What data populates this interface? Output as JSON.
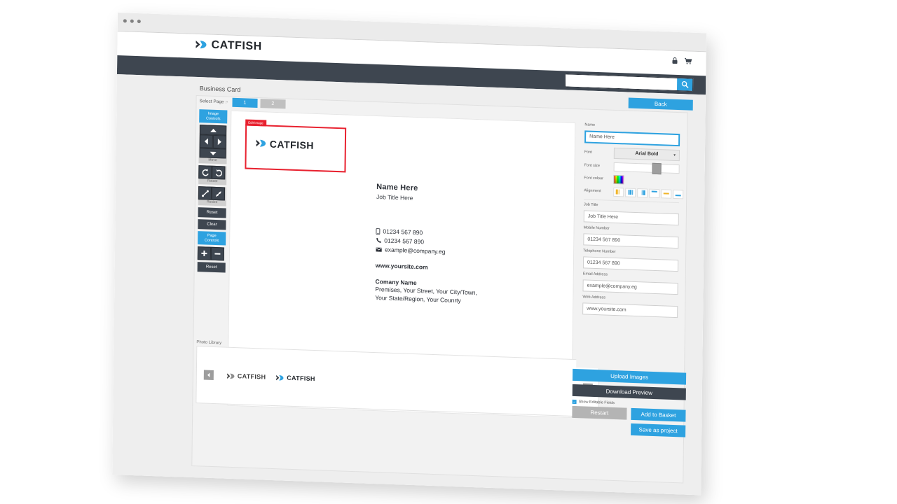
{
  "browser": {
    "dots": 3
  },
  "header": {
    "logo_word": "CATFISH",
    "lock_icon": "lock-icon",
    "cart_icon": "cart-icon"
  },
  "nav": {
    "search_value": "",
    "search_placeholder": "",
    "search_icon": "search-icon"
  },
  "toolbar_top": {
    "back_label": "Back"
  },
  "designer": {
    "title": "Business Card",
    "select_page_label": "Select Page :-",
    "pages": [
      {
        "label": "1",
        "active": true
      },
      {
        "label": "2",
        "active": false
      }
    ]
  },
  "tools": {
    "image_controls_label": "Image\nControls",
    "image_controls_line1": "Image",
    "image_controls_line2": "Controls",
    "move_label": "Move",
    "rotate_label": "Rotate",
    "resize_label": "Resize",
    "reset_label": "Reset",
    "clear_label": "Clear",
    "page_controls_line1": "Page",
    "page_controls_line2": "Controls",
    "page_reset_label": "Reset",
    "icons": {
      "up": "arrow-up-icon",
      "down": "arrow-down-icon",
      "left": "arrow-left-icon",
      "right": "arrow-right-icon",
      "rotate_ccw": "rotate-counterclockwise-icon",
      "rotate_cw": "rotate-clockwise-icon",
      "grow": "resize-grow-icon",
      "shrink": "resize-shrink-icon",
      "plus": "plus-icon",
      "minus": "minus-icon"
    }
  },
  "card": {
    "logo_tag": "Edit Image",
    "logo_word": "CATFISH",
    "name": "Name Here",
    "job_title": "Job Title Here",
    "mobile": "01234 567 890",
    "telephone": "01234 567 890",
    "email": "example@company.eg",
    "website": "www.yoursite.com",
    "company": "Comany Name",
    "address_line1": "Premises, Your Street, Your City/Town,",
    "address_line2": "Your State/Region, Your Counrty",
    "mobile_icon": "mobile-phone-icon",
    "phone_icon": "telephone-icon",
    "email_icon": "envelope-icon"
  },
  "photo_library": {
    "title": "Photo Library",
    "prev_icon": "chevron-left-icon",
    "next_icon": "chevron-right-icon",
    "thumbs": [
      {
        "word": "CATFISH",
        "style": "grey"
      },
      {
        "word": "CATFISH",
        "style": "blue"
      }
    ]
  },
  "properties": {
    "name": {
      "label": "Name",
      "value": "Name Here",
      "focused": true
    },
    "font": {
      "label": "Font",
      "value": "Arial Bold",
      "caret_icon": "chevron-down-icon"
    },
    "font_size": {
      "label": "Font size",
      "value": 60
    },
    "font_colour": {
      "label": "Font colour",
      "swatch_icon": "colour-picker-icon"
    },
    "alignment": {
      "label": "Alignment",
      "buttons": [
        {
          "name": "align-left-icon",
          "active": true
        },
        {
          "name": "align-center-icon",
          "active": false
        },
        {
          "name": "align-right-icon",
          "active": false
        },
        {
          "name": "align-top-icon",
          "active": false
        },
        {
          "name": "align-middle-icon",
          "active": true
        },
        {
          "name": "align-bottom-icon",
          "active": false
        }
      ]
    },
    "job_title": {
      "label": "Job Title",
      "value": "Job Title Here"
    },
    "mobile_number": {
      "label": "Mobile Number",
      "value": "01234 567 890"
    },
    "telephone_number": {
      "label": "Telephone Number",
      "value": "01234 567 890"
    },
    "email_address": {
      "label": "Email Address",
      "value": "example@company.eg"
    },
    "web_address": {
      "label": "Web Address",
      "value": "www.yoursite.com"
    }
  },
  "actions": {
    "upload_images": "Upload Images",
    "download_preview": "Download Preview",
    "show_editable_fields": "Show Editable Fields",
    "show_editable_checked": true,
    "restart": "Restart",
    "add_to_basket": "Add to Basket",
    "save_as_project": "Save as project"
  },
  "colors": {
    "accent_blue": "#2ea2e0",
    "dark_slate": "#3e4650",
    "alert_red": "#e8212f",
    "page_grey": "#eeeeee"
  }
}
